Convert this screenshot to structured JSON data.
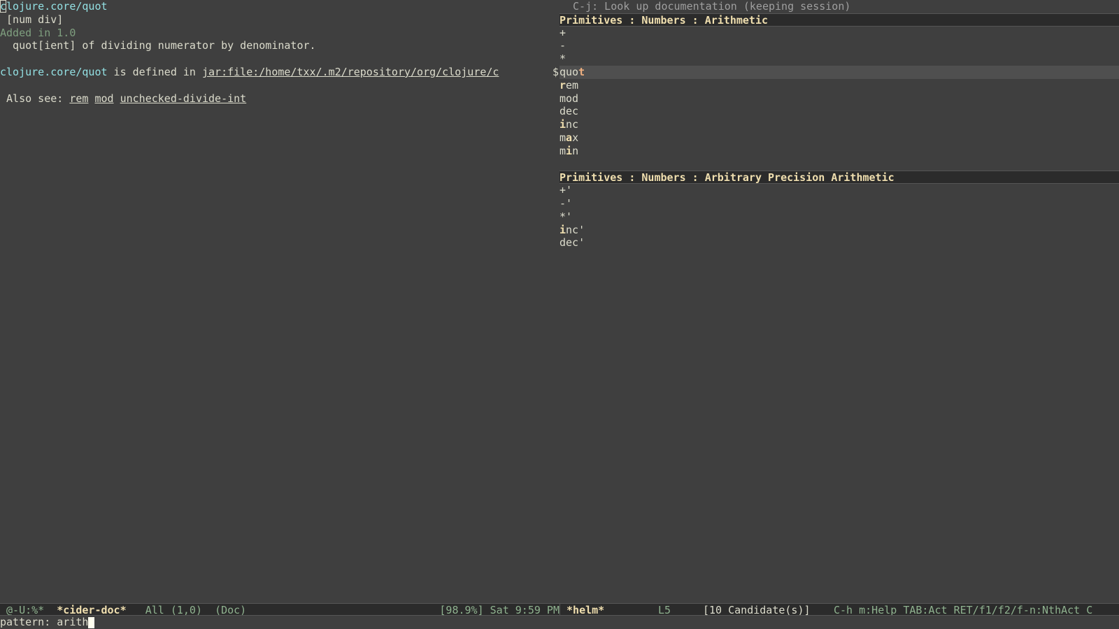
{
  "doc": {
    "cursor_char": "c",
    "symbol_rest": "lojure.core/quot",
    "arglist": " [num div]",
    "added": "Added in 1.0",
    "docstring": "  quot[ient] of dividing numerator by denominator.",
    "defined_symbol": "clojure.core/quot",
    "defined_text": " is defined in ",
    "defined_link": "jar:file:/home/txx/.m2/repository/org/clojure/c",
    "truncation": "$",
    "also_see_label": " Also see: ",
    "also_see": [
      "rem",
      "mod",
      "unchecked-divide-int"
    ]
  },
  "helm": {
    "header_line": " C-j: Look up documentation (keeping session)",
    "sources": [
      {
        "title": "Primitives : Numbers : Arithmetic",
        "candidates": [
          {
            "pre": "+",
            "match": "",
            "post": ""
          },
          {
            "pre": "-",
            "match": "",
            "post": ""
          },
          {
            "pre": "*",
            "match": "",
            "post": ""
          },
          {
            "pre": "quo",
            "match": "t",
            "post": "",
            "selected": true
          },
          {
            "pre": "",
            "match": "r",
            "post": "em"
          },
          {
            "pre": "mod",
            "match": "",
            "post": ""
          },
          {
            "pre": "dec",
            "match": "",
            "post": ""
          },
          {
            "pre": "",
            "match": "i",
            "post": "nc"
          },
          {
            "pre": "m",
            "match": "a",
            "post": "x"
          },
          {
            "pre": "m",
            "match": "i",
            "post": "n"
          }
        ]
      },
      {
        "title": "Primitives : Numbers : Arbitrary Precision Arithmetic",
        "candidates": [
          {
            "pre": "+'",
            "match": "",
            "post": ""
          },
          {
            "pre": "-'",
            "match": "",
            "post": ""
          },
          {
            "pre": "*'",
            "match": "",
            "post": ""
          },
          {
            "pre": "",
            "match": "i",
            "post": "nc'"
          },
          {
            "pre": "dec'",
            "match": "",
            "post": ""
          }
        ]
      }
    ]
  },
  "modeline": {
    "left_status": " @-U:%*  ",
    "left_buffer": "*cider-doc*",
    "left_position": "   All (1,0)  ",
    "left_mode": "(Doc)",
    "left_misc": "[98.9%] Sat 9:59 PM",
    "right_buffer": " *helm*",
    "right_line": "L5",
    "right_count": "[10 Candidate(s)]",
    "right_help": "C-h m:Help TAB:Act RET/f1/f2/f-n:NthAct C"
  },
  "minibuffer": {
    "prompt": "pattern: ",
    "input": "arith"
  }
}
